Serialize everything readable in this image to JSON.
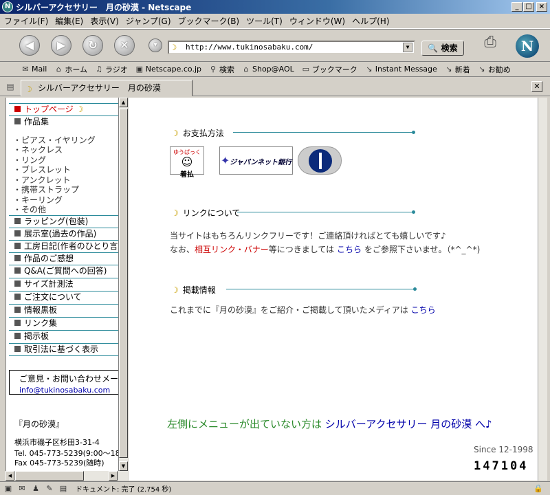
{
  "window": {
    "title": "シルバーアクセサリー　月の砂漠 - Netscape"
  },
  "menu": [
    "ファイル(F)",
    "編集(E)",
    "表示(V)",
    "ジャンプ(G)",
    "ブックマーク(B)",
    "ツール(T)",
    "ウィンドウ(W)",
    "ヘルプ(H)"
  ],
  "toolbar": {
    "url": "http://www.tukinosabaku.com/",
    "search_label": "検索"
  },
  "personal_toolbar": [
    "Mail",
    "ホーム",
    "ラジオ",
    "Netscape.co.jp",
    "検索",
    "Shop@AOL",
    "ブックマーク",
    "Instant Message",
    "新着",
    "お勧め"
  ],
  "tab": {
    "title": "シルバーアクセサリー　月の砂漠"
  },
  "sidebar": {
    "top_page": "トップページ",
    "works": "作品集",
    "sub_items": [
      "・ピアス・イヤリング",
      "・ネックレス",
      "・リング",
      "・ブレスレット",
      "・アンクレット",
      "・携帯ストラップ",
      "・キーリング",
      "・その他"
    ],
    "menu_items": [
      "ラッピング(包装)",
      "展示室(過去の作品)",
      "工房日記(作者のひとり言)",
      "作品のご感想",
      "Q&A(ご質問への回答)",
      "サイズ計測法",
      "ご注文について",
      "情報黒板",
      "リンク集",
      "掲示板",
      "取引法に基づく表示"
    ],
    "contact_title": "ご意見・お問い合わせメール",
    "contact_email": "info@tukinosabaku.com　ま",
    "shop_name": "『月の砂漠』",
    "address": "横浜市磯子区杉田3-31-4",
    "tel": "Tel. 045-773-5239(9:00～18",
    "fax": "Fax 045-773-5239(随時)"
  },
  "main": {
    "payment": {
      "title": "お支払方法",
      "icons": [
        {
          "name": "着払",
          "top": "ゆうぱっく"
        },
        {
          "name": "ジャパンネット銀行"
        },
        {
          "name": ""
        }
      ]
    },
    "links": {
      "title": "リンクについて",
      "line1": "当サイトはもちろんリンクフリーです！ご連絡頂ければとても嬉しいです♪",
      "line2_pre": "なお、",
      "line2_red": "相互リンク・バナー",
      "line2_mid": "等につきましては",
      "line2_link": "こちら",
      "line2_post": "をご参照下さいませ。（*^_^*)"
    },
    "media": {
      "title": "掲載情報",
      "line_pre": "これまでに『月の砂漠』をご紹介・ご掲載して頂いたメディアは",
      "line_link": "こちら"
    },
    "bottom_pre": "左側にメニューが出ていない方は",
    "bottom_link": "シルバーアクセサリー 月の砂漠 へ♪",
    "since": "Since 12-1998",
    "counter": "147104"
  },
  "status": {
    "text": "ドキュメント: 完了 (2.754 秒)"
  }
}
